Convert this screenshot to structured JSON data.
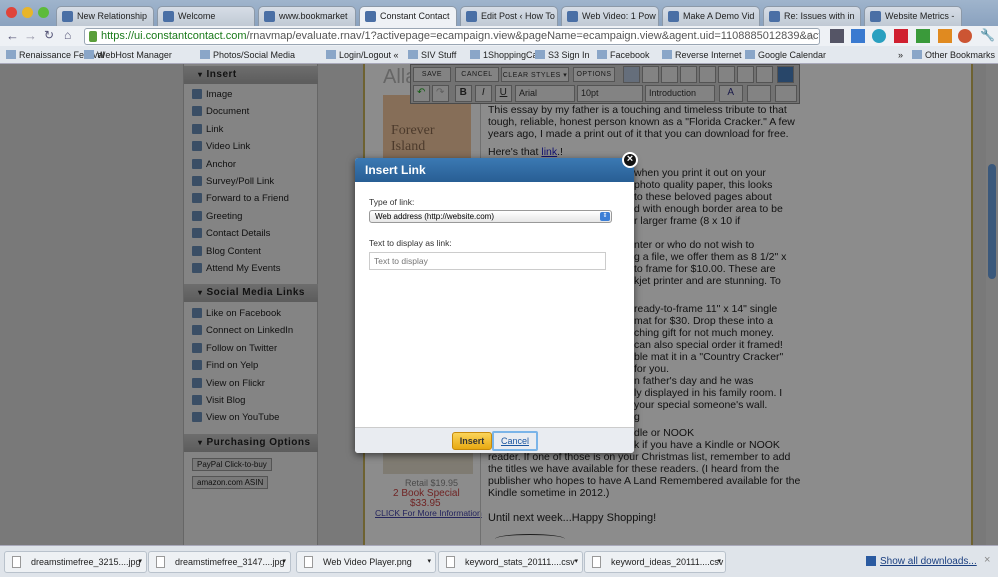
{
  "browser": {
    "tabs": [
      "New Relationship",
      "Welcome",
      "www.bookmarket",
      "Constant Contact",
      "Edit Post ‹ How To",
      "Web Video: 1 Pow",
      "Make A Demo Vid",
      "Re: Issues with in",
      "Website Metrics -"
    ],
    "active_tab": 3,
    "url_host": "https://ui.constantcontact.com",
    "url_rest": "/rnavmap/evaluate.rnav/1?activepage=ecampaign.view&pageName=ecampaign.view&agent.uid=1108885012839&action=ne...",
    "bookmarks": [
      "Renaissance Festival",
      "WebHost Manager",
      "Photos/Social Media",
      "Login/Logout «",
      "SIV Stuff",
      "1ShoppingCart",
      "S3 Sign In",
      "Facebook",
      "Reverse Internet",
      "Google Calendar"
    ],
    "other_bookmarks": "Other Bookmarks"
  },
  "sidebar": {
    "insert": {
      "title": "Insert",
      "items": [
        "Image",
        "Document",
        "Link",
        "Video Link",
        "Anchor",
        "Survey/Poll Link",
        "Forward to a Friend",
        "Greeting",
        "Contact Details",
        "Blog Content",
        "Attend My Events"
      ]
    },
    "social": {
      "title": "Social Media Links",
      "items": [
        "Like on Facebook",
        "Connect on LinkedIn",
        "Follow on Twitter",
        "Find on Yelp",
        "View on Flickr",
        "Visit Blog",
        "View on YouTube"
      ]
    },
    "purchasing": {
      "title": "Purchasing Options",
      "items": [
        "PayPal  Click-to-buy",
        "amazon.com  ASIN"
      ]
    }
  },
  "toolbar": {
    "buttons": [
      "SAVE",
      "CANCEL",
      "CLEAR STYLES ▾",
      "OPTIONS"
    ],
    "font": "Arial",
    "size": "10pt",
    "style": "Introduction",
    "bold": "B",
    "italic": "I",
    "underline": "U"
  },
  "article": {
    "title_fragment": "Alla",
    "book_cover": "Forever Island",
    "retail": "Retail $19.95",
    "special": "2 Book Special",
    "price": "$33.95",
    "more_info": "CLICK For More Information",
    "lines_top": [
      "This essay by my father is a touching and timeless tribute to that",
      "tough, reliable, honest person known as a \"Florida Cracker.\" A few",
      "years ago, I made a print out of it that you can download for free."
    ],
    "link_line": "Here's that ",
    "link_text": "link",
    "link_after": ".!",
    "lines_partial": [
      "when you print it out on your",
      "photo quality paper, this looks",
      "to these beloved pages about",
      "d with enough border area to be",
      "r larger frame (8 x 10 if",
      "nter or who do not wish to",
      "g a file, we offer them as 8 1/2\" x",
      "to frame for $10.00. These are",
      "kjet printer and are stunning. To",
      "ready-to-frame 11\" x 14\" single",
      "mat for $30. Drop these into a",
      "ching gift for not much money.",
      "can also special order it framed!",
      "ble mat it in a \"Country Cracker\"",
      "for you.",
      "n father's day and he was",
      "ly displayed in his family room. I",
      "your special someone's wall.",
      "g",
      "dle or NOOK",
      "k if you have a Kindle or NOOK"
    ],
    "lines_bottom": [
      "reader. If one of those is on your Christmas list, remember to add",
      "the titles we have available for these readers. (I heard from the",
      "publisher who hopes to have A Land Remembered available for the",
      "Kindle sometime in 2012.)"
    ],
    "closing": "Until next week...Happy Shopping!"
  },
  "dialog": {
    "title": "Insert Link",
    "type_label": "Type of link:",
    "type_value": "Web address (http://website.com)",
    "text_label": "Text to display as link:",
    "text_placeholder": "Text to display",
    "text_value": "",
    "insert": "Insert",
    "cancel": "Cancel"
  },
  "downloads": {
    "items": [
      "dreamstimefree_3215....jpg",
      "dreamstimefree_3147....jpg",
      "Web Video Player.png",
      "keyword_stats_20111....csv",
      "keyword_ideas_20111....csv"
    ],
    "show_all": "Show all downloads..."
  }
}
